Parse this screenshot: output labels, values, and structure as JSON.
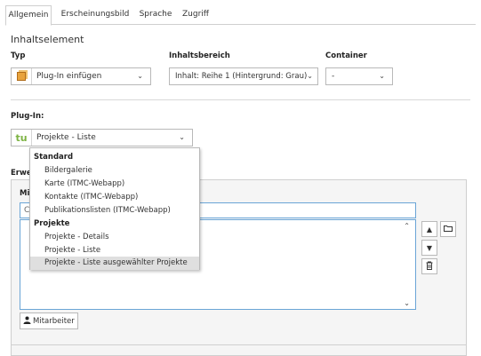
{
  "tabs": [
    {
      "label": "Allgemein"
    },
    {
      "label": "Erscheinungsbild"
    },
    {
      "label": "Sprache"
    },
    {
      "label": "Zugriff"
    }
  ],
  "section_title": "Inhaltselement",
  "fields": {
    "typ_label": "Typ",
    "typ_value": "Plug-In einfügen",
    "inhaltsbereich_label": "Inhaltsbereich",
    "inhaltsbereich_value": "Inhalt: Reihe 1 (Hintergrund: Grau)",
    "container_label": "Container",
    "container_value": "-"
  },
  "plugin": {
    "label": "Plug-In:",
    "icon_text": "tu",
    "value": "Projekte - Liste"
  },
  "panel": {
    "label_partial": "Erwe",
    "sub_label_partial": "Mit",
    "search_partial": "C",
    "button_label": "Mitarbeiter"
  },
  "dropdown": {
    "groups": [
      {
        "label": "Standard",
        "options": [
          "Bildergalerie",
          "Karte (ITMC-Webapp)",
          "Kontakte (ITMC-Webapp)",
          "Publikationslisten (ITMC-Webapp)"
        ]
      },
      {
        "label": "Projekte",
        "options": [
          "Projekte - Details",
          "Projekte - Liste",
          "Projekte - Liste ausgewählter Projekte"
        ]
      }
    ],
    "highlighted": "Projekte - Liste ausgewählter Projekte"
  },
  "icons": {
    "chevron": "chevron-down-icon",
    "up": "arrow-up-icon",
    "down": "arrow-down-icon",
    "folder": "folder-icon",
    "trash": "trash-icon",
    "user": "user-icon"
  }
}
